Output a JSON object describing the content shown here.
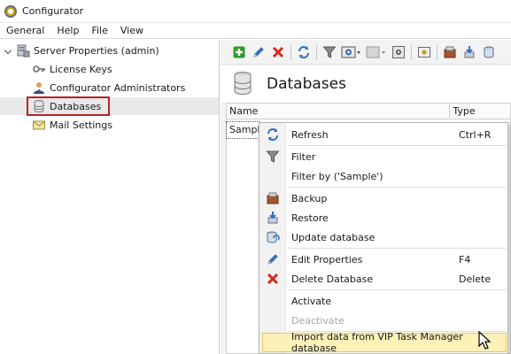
{
  "window": {
    "title": "Configurator"
  },
  "menubar": {
    "items": [
      "General",
      "Help",
      "File",
      "View"
    ]
  },
  "tree": {
    "root": "Server Properties (admin)",
    "children": [
      "License Keys",
      "Configurator Administrators",
      "Databases",
      "Mail Settings"
    ]
  },
  "page": {
    "title": "Databases"
  },
  "grid": {
    "columns": [
      "Name",
      "Type"
    ],
    "rows": [
      {
        "name": "Sample",
        "type": ""
      }
    ]
  },
  "context_menu": {
    "refresh": {
      "label": "Refresh",
      "shortcut": "Ctrl+R"
    },
    "filter": {
      "label": "Filter"
    },
    "filter_by": {
      "label": "Filter by ('Sample')"
    },
    "backup": {
      "label": "Backup"
    },
    "restore": {
      "label": "Restore"
    },
    "update": {
      "label": "Update database"
    },
    "edit": {
      "label": "Edit Properties",
      "shortcut": "F4"
    },
    "delete": {
      "label": "Delete Database",
      "shortcut": "Delete"
    },
    "activate": {
      "label": "Activate"
    },
    "deactivate": {
      "label": "Deactivate"
    },
    "import": {
      "label": "Import data from VIP Task Manager database"
    }
  },
  "colors": {
    "selection_outline": "#b3242a",
    "menu_highlight": "#fdf1b8",
    "delete_red": "#d9261c",
    "add_green": "#2e9b2e"
  }
}
